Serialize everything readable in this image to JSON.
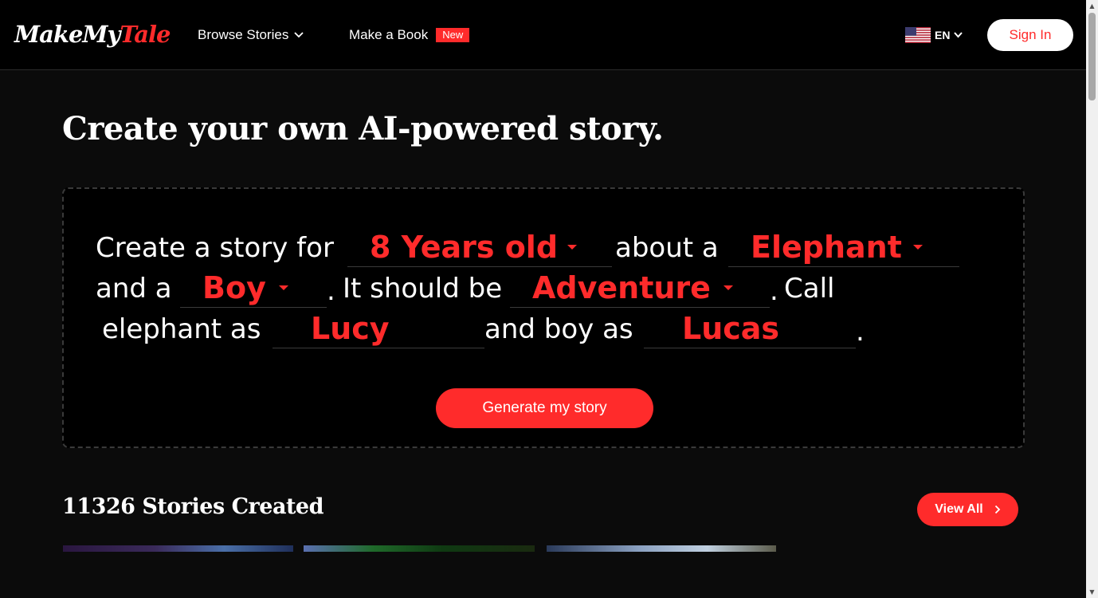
{
  "header": {
    "logo_part1": "MakeMy",
    "logo_part2": "Tale",
    "nav_browse": "Browse Stories",
    "nav_make": "Make a Book",
    "badge_new": "New",
    "language": "EN",
    "signin": "Sign In"
  },
  "main": {
    "title": "Create your own AI-powered story.",
    "sentence": {
      "t1": "Create a story for",
      "age": "8 Years old",
      "t2": "about a",
      "animal": "Elephant",
      "t3": "and a",
      "gender": "Boy",
      "t4": ".",
      "t5": "It should be",
      "genre": "Adventure",
      "t6": ".",
      "t7": "Call",
      "t8": "elephant as",
      "animal_name": "Lucy",
      "t9": "and boy as",
      "child_name": "Lucas",
      "t10": "."
    },
    "generate": "Generate my story",
    "stories_count_title": "11326 Stories Created",
    "view_all": "View All"
  },
  "colors": {
    "accent": "#ff2b2b",
    "background": "#0b0b0b"
  }
}
